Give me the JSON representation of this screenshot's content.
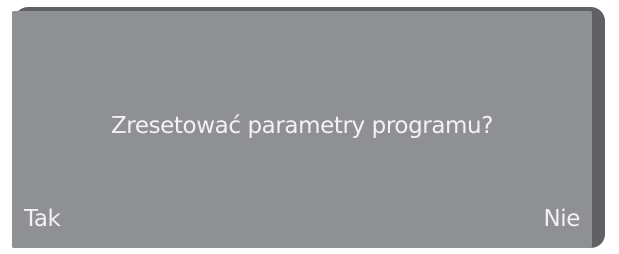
{
  "dialog": {
    "prompt": "Zresetować parametry programu?",
    "yes_label": "Tak",
    "no_label": "Nie"
  },
  "colors": {
    "frame": "#5f6164",
    "screen": "#8e9093",
    "text": "#f2f2f2"
  }
}
